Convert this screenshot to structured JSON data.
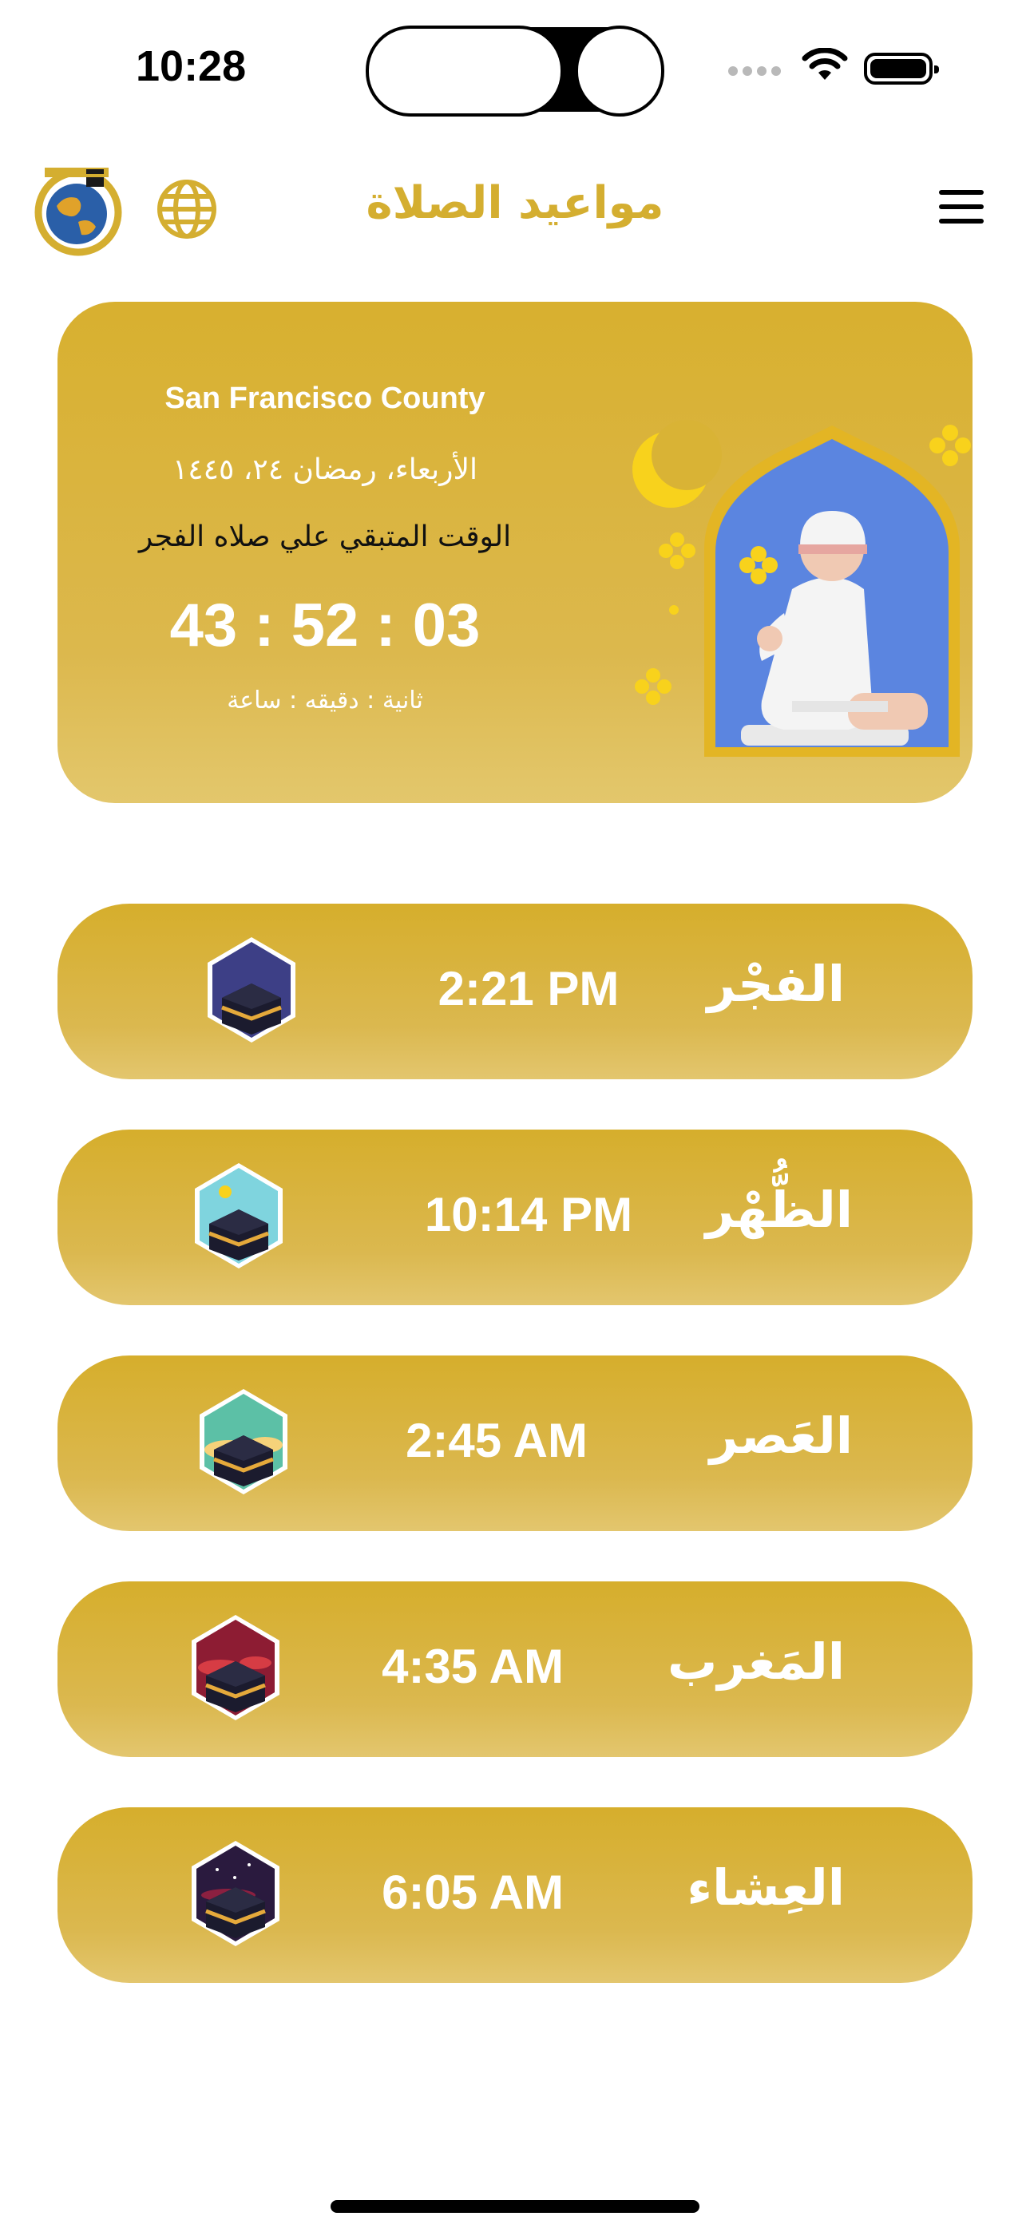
{
  "status_bar": {
    "time": "10:28"
  },
  "header": {
    "title": "مواعيد الصلاة"
  },
  "info_card": {
    "location": "San Francisco County",
    "hijri_date": "الأربعاء، رمضان ٢٤، ١٤٤٥",
    "remaining_label": "الوقت المتبقي علي صلاه الفجر",
    "countdown": "43 : 52 : 03",
    "units": "ثانية : دقيقه : ساعة"
  },
  "prayers": [
    {
      "name": "الفجْر",
      "time": "2:21 PM",
      "icon": "fajr-kaaba-icon"
    },
    {
      "name": "الظُّهْر",
      "time": "10:14 PM",
      "icon": "dhuhr-kaaba-icon"
    },
    {
      "name": "العَصر",
      "time": "2:45 AM",
      "icon": "asr-kaaba-icon"
    },
    {
      "name": "المَغرب",
      "time": "4:35 AM",
      "icon": "maghrib-kaaba-icon"
    },
    {
      "name": "العِشاء",
      "time": "6:05 AM",
      "icon": "isha-kaaba-icon"
    }
  ],
  "colors": {
    "accent": "#d4ae30",
    "card": "#d8b02f",
    "title": "#d4ae30"
  }
}
